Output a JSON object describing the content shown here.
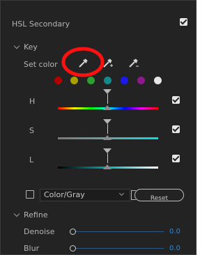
{
  "header": {
    "title": "HSL Secondary"
  },
  "key": {
    "section_label": "Key",
    "set_color_label": "Set color"
  },
  "swatch_colors": [
    "#b00000",
    "#a8a000",
    "#2f9f2f",
    "#168a8a",
    "#1a1af0",
    "#8c1a8c",
    "#e6e6e6"
  ],
  "hsl": {
    "h_label": "H",
    "s_label": "S",
    "l_label": "L"
  },
  "colorgray": {
    "select_value": "Color/Gray",
    "reset_label": "Reset"
  },
  "refine": {
    "section_label": "Refine",
    "denoise_label": "Denoise",
    "denoise_value": "0.0",
    "blur_label": "Blur",
    "blur_value": "0.0"
  }
}
